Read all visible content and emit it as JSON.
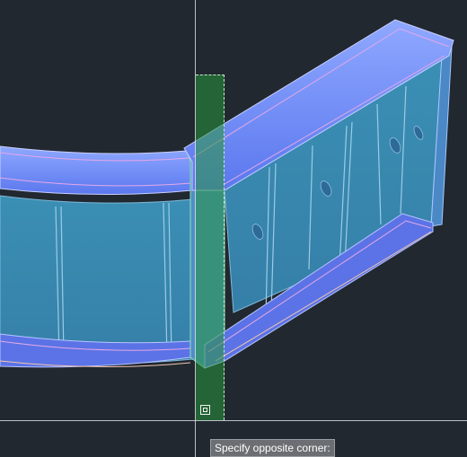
{
  "viewport": {
    "background": "#212830"
  },
  "selection": {
    "mode": "crossing-window",
    "fill_color": "#2a963c"
  },
  "tooltip": {
    "prompt": "Specify opposite corner:"
  }
}
